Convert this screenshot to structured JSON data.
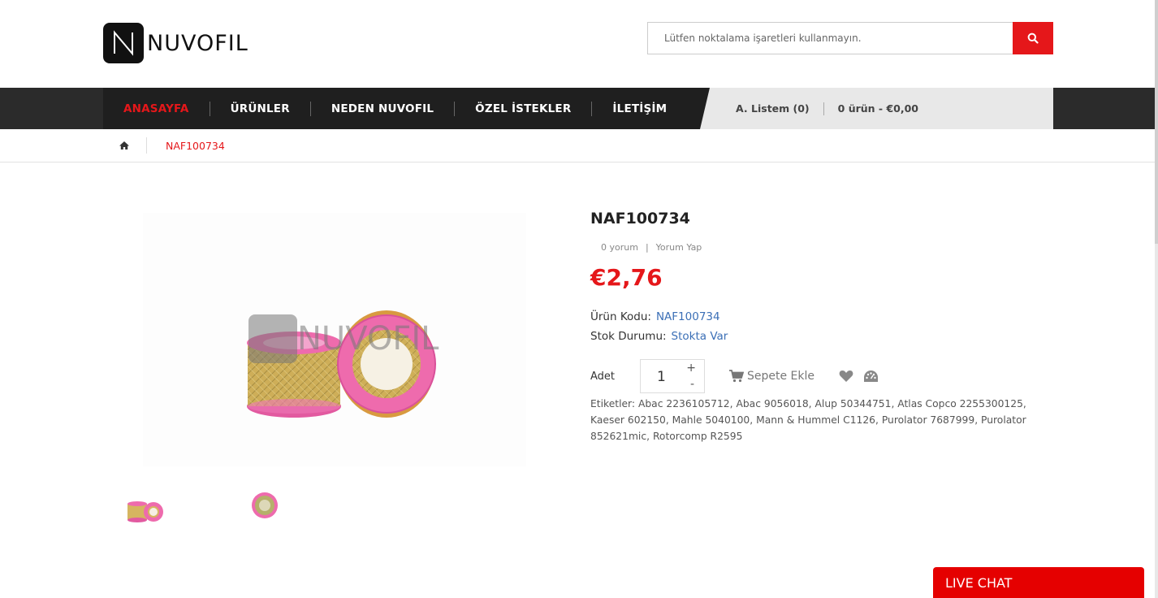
{
  "brand": {
    "name": "NUVOFIL",
    "accent": "#e5171a"
  },
  "search": {
    "placeholder": "Lütfen noktalama işaretleri kullanmayın."
  },
  "nav": {
    "items": [
      {
        "label": "ANASAYFA",
        "active": true
      },
      {
        "label": "ÜRÜNLER"
      },
      {
        "label": "NEDEN NUVOFIL"
      },
      {
        "label": "ÖZEL İSTEKLER"
      },
      {
        "label": "İLETİŞİM"
      }
    ],
    "wishlist_label": "A. Listem (0)",
    "cart_label": "0 ürün - €0,00"
  },
  "breadcrumb": {
    "home_icon": "home-icon",
    "current": "NAF100734"
  },
  "product": {
    "title": "NAF100734",
    "reviews_label": "0 yorum",
    "write_review_label": "Yorum Yap",
    "price": "€2,76",
    "code_label": "Ürün Kodu:",
    "code_value": "NAF100734",
    "stock_label": "Stok Durumu:",
    "stock_value": "Stokta Var",
    "qty_label": "Adet",
    "qty_value": "1",
    "qty_plus": "+",
    "qty_minus": "-",
    "add_to_cart_label": "Sepete Ekle",
    "image_watermark": "NUVOFIL",
    "tags_label": "Etiketler:",
    "tags": [
      "Abac 2236105712",
      "Abac 9056018",
      "Alup 50344751",
      "Atlas Copco 2255300125",
      "Kaeser 602150",
      "Mahle 5040100",
      "Mann & Hummel C1126",
      "Purolator 7687999",
      "Purolator 852621mic",
      "Rotorcomp R2595"
    ]
  },
  "live_chat": {
    "label": "LIVE CHAT"
  }
}
